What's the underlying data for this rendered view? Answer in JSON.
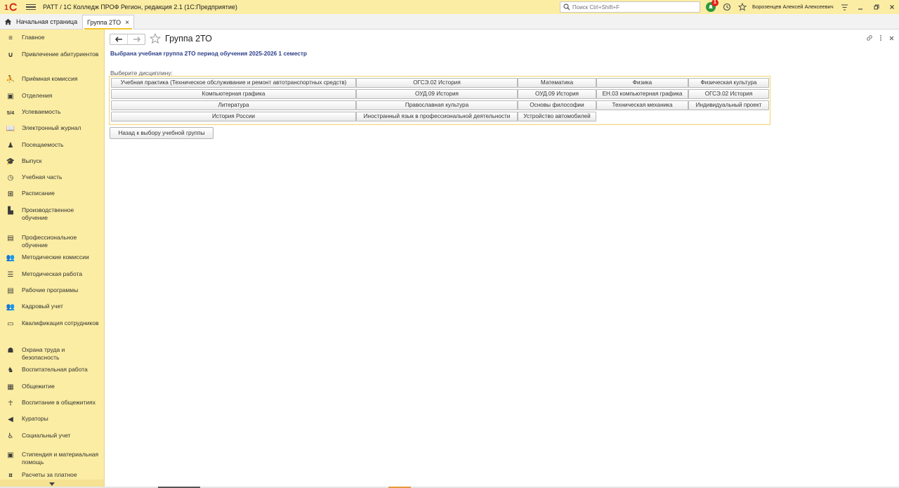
{
  "app": {
    "logo_text": "1С",
    "title": "РАТТ / 1С Колледж ПРОФ Регион, редакция 2.1  (1С:Предприятие)",
    "search_placeholder": "Поиск Ctrl+Shift+F",
    "notification_count": "1",
    "user_name": "Борозенцев Алексей Алексеевич"
  },
  "tabs": {
    "home_label": "Начальная страница",
    "active_label": "Группа 2ТО"
  },
  "sidebar": {
    "items": [
      {
        "label": "Главное",
        "icon": "menu-lines-icon"
      },
      {
        "label": "Привлечение абитуриентов",
        "icon": "magnet-icon"
      },
      {
        "label": "Приёмная комиссия",
        "icon": "walking-person-icon"
      },
      {
        "label": "Отделения",
        "icon": "square-document-icon"
      },
      {
        "label": "Успеваемость",
        "icon": "grade-fraction-icon"
      },
      {
        "label": "Электронный журнал",
        "icon": "open-book-icon"
      },
      {
        "label": "Посещаемость",
        "icon": "person-at-desk-icon"
      },
      {
        "label": "Выпуск",
        "icon": "graduation-cap-icon"
      },
      {
        "label": "Учебная часть",
        "icon": "clock-icon"
      },
      {
        "label": "Расписание",
        "icon": "schedule-grid-icon"
      },
      {
        "label": "Производственное обучение",
        "icon": "factory-icon"
      },
      {
        "label": "Профессиональное обучение",
        "icon": "bus-icon"
      },
      {
        "label": "Методические комиссии",
        "icon": "people-group-icon"
      },
      {
        "label": "Методическая работа",
        "icon": "books-stack-icon"
      },
      {
        "label": "Рабочие программы",
        "icon": "document-icon"
      },
      {
        "label": "Кадровый учет",
        "icon": "people-icon"
      },
      {
        "label": "Квалификация сотрудников",
        "icon": "certificate-icon"
      },
      {
        "label": "Охрана труда и безопасность",
        "icon": "worker-icon"
      },
      {
        "label": "Воспитательная работа",
        "icon": "teacher-icon"
      },
      {
        "label": "Общежитие",
        "icon": "building-icon"
      },
      {
        "label": "Воспитание в общежитиях",
        "icon": "family-icon"
      },
      {
        "label": "Кураторы",
        "icon": "megaphone-icon"
      },
      {
        "label": "Социальный учет",
        "icon": "wheelchair-icon"
      },
      {
        "label": "Стипендия и материальная помощь",
        "icon": "wallet-icon"
      },
      {
        "label": "Расчеты за платное",
        "icon": "money-icon"
      }
    ]
  },
  "main": {
    "page_title": "Группа 2ТО",
    "info_text": "Выбрана учебная группа 2ТО период обучения 2025-2026 1 семестр",
    "choose_label": "Выберите дисциплину:",
    "disciplines": [
      [
        "Учебная практика (Техническое обслуживание и ремонт автотранспортных средств)",
        "ОГСЭ.02 История",
        "Математика",
        "Физика",
        "Физическая культура"
      ],
      [
        "Компьютерная графика",
        "ОУД.09 История",
        "ОУД.09 История",
        "ЕН.03 компьютерная графика",
        "ОГСЭ.02 История"
      ],
      [
        "Литература",
        "Православная культура",
        "Основы философии",
        "Техническая механика",
        "Индивидуальный проект"
      ],
      [
        "История России",
        "Иностранный язык в профессиональной деятельности",
        "Устройство автомобилей"
      ]
    ],
    "back_button": "Назад к выбору учебной группы"
  },
  "colors": {
    "panel_yellow": "#fbeda3",
    "title_blue": "#2c3e8a",
    "accent_gold": "#f5c42a",
    "notify_green": "#2d9a3c",
    "badge_red": "#e2231a"
  }
}
